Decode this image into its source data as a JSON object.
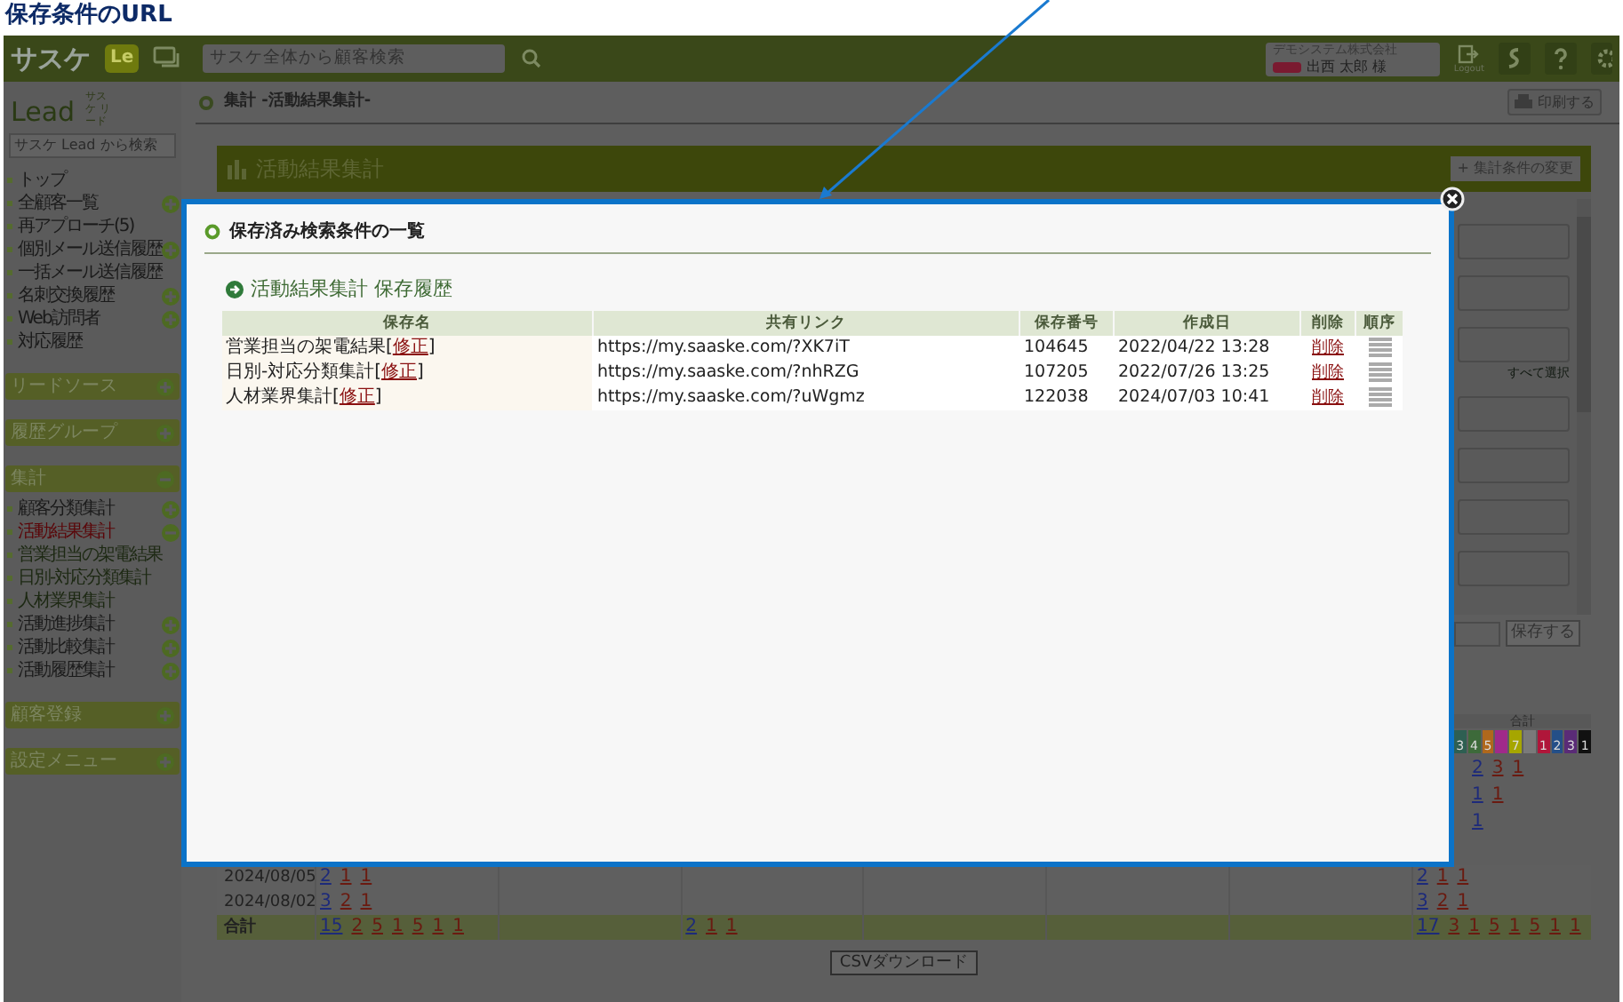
{
  "annotation": {
    "title": "保存条件のURL"
  },
  "header": {
    "logo": "サスケ",
    "app_badge": "Le",
    "search": {
      "placeholder": "サスケ全体から顧客検索"
    },
    "company": "デモシステム株式会社",
    "user": "出西 太郎 様",
    "logout": "Logout"
  },
  "sidebar": {
    "logo": "Lead",
    "logo_sub": "サスケ リード",
    "search": {
      "placeholder": "サスケ Lead から検索"
    },
    "items": [
      {
        "label": "トップ",
        "selected": false
      },
      {
        "label": "全顧客一覧",
        "selected": false,
        "expandable": true,
        "expanded": false
      },
      {
        "label": "再アプローチ(5)",
        "selected": false
      },
      {
        "label": "個別メール送信履歴",
        "selected": false,
        "expandable": true,
        "expanded": false
      },
      {
        "label": "一括メール送信履歴",
        "selected": false
      },
      {
        "label": "名刺交換履歴",
        "selected": false,
        "expandable": true,
        "expanded": false
      },
      {
        "label": "Web訪問者",
        "selected": false,
        "expandable": true,
        "expanded": false
      },
      {
        "label": "対応履歴",
        "selected": false
      }
    ],
    "sections": [
      {
        "title": "リードソース",
        "expanded": false
      },
      {
        "title": "履歴グループ",
        "expanded": false
      },
      {
        "title": "集計",
        "expanded": true,
        "items": [
          {
            "label": "顧客分類集計",
            "selected": false,
            "expandable": true,
            "expanded": false
          },
          {
            "label": "活動結果集計",
            "selected": true,
            "expandable": true,
            "expanded": true,
            "children": [
              {
                "label": "営業担当の架電結果",
                "selected": false
              },
              {
                "label": "日別-対応分類集計",
                "selected": false
              },
              {
                "label": "人材業界集計",
                "selected": false
              }
            ]
          },
          {
            "label": "活動進捗集計",
            "selected": false,
            "expandable": true,
            "expanded": false
          },
          {
            "label": "活動比較集計",
            "selected": false,
            "expandable": true,
            "expanded": false
          },
          {
            "label": "活動履歴集計",
            "selected": false,
            "expandable": true,
            "expanded": false
          }
        ]
      },
      {
        "title": "顧客登録",
        "expanded": false
      },
      {
        "title": "設定メニュー",
        "expanded": false
      }
    ]
  },
  "main": {
    "breadcrumb": "集計 -活動結果集計-",
    "print_button": "印刷する",
    "panel_title": "活動結果集計",
    "change_button": "+ 集計条件の変更",
    "select_all": "すべて選択",
    "save_button": "保存する",
    "totals": {
      "title": "合計",
      "badges": [
        {
          "label": "3",
          "color": "#2e5f52"
        },
        {
          "label": "4",
          "color": "#3d6a3a"
        },
        {
          "label": "5",
          "color": "#b0681c"
        },
        {
          "color": "#a02a8a"
        },
        {
          "label": "7",
          "color": "#a6a600"
        },
        {
          "color": "#7a7a7a"
        },
        {
          "label": "1",
          "color": "#b0163a"
        },
        {
          "label": "2",
          "color": "#244f88"
        },
        {
          "label": "3",
          "color": "#5a2b77"
        },
        {
          "label": "1",
          "color": "#111111"
        }
      ],
      "rows": [
        [
          "2",
          "3",
          "1"
        ],
        [
          "1",
          "1"
        ],
        [
          "1"
        ]
      ]
    },
    "table": {
      "rows": [
        {
          "label": "2024/08/05",
          "total": false,
          "groups": [
            {
              "kind": "counts",
              "values": [
                "2",
                "1",
                "1"
              ]
            },
            {
              "kind": "empty"
            },
            {
              "kind": "empty"
            },
            {
              "kind": "empty"
            },
            {
              "kind": "empty"
            },
            {
              "kind": "empty"
            },
            {
              "kind": "counts",
              "values": [
                "2",
                "1",
                "1"
              ]
            }
          ]
        },
        {
          "label": "2024/08/02",
          "total": false,
          "groups": [
            {
              "kind": "counts",
              "values": [
                "3",
                "2",
                "1"
              ]
            },
            {
              "kind": "empty"
            },
            {
              "kind": "empty"
            },
            {
              "kind": "empty"
            },
            {
              "kind": "empty"
            },
            {
              "kind": "empty"
            },
            {
              "kind": "counts",
              "values": [
                "3",
                "2",
                "1"
              ]
            }
          ]
        },
        {
          "label": "合計",
          "total": true,
          "groups": [
            {
              "kind": "counts",
              "values": [
                "15",
                "2",
                "5",
                "1",
                "5",
                "1",
                "1"
              ]
            },
            {
              "kind": "empty"
            },
            {
              "kind": "counts",
              "values": [
                "2",
                "1",
                "1"
              ]
            },
            {
              "kind": "empty"
            },
            {
              "kind": "empty"
            },
            {
              "kind": "empty"
            },
            {
              "kind": "counts",
              "values": [
                "17",
                "3",
                "1",
                "5",
                "1",
                "5",
                "1",
                "1"
              ]
            }
          ]
        }
      ]
    },
    "csv_button": "CSVダウンロード"
  },
  "modal": {
    "title": "保存済み検索条件の一覧",
    "section": "活動結果集計 保存履歴",
    "columns": [
      "保存名",
      "共有リンク",
      "保存番号",
      "作成日",
      "削除",
      "順序"
    ],
    "rows": [
      {
        "name": "営業担当の架電結果",
        "edit": {
          "open": "[",
          "label": "修正",
          "close": "]"
        },
        "link": "https://my.saaske.com/?XK7iT",
        "number": "104645",
        "date": "2022/04/22 13:28",
        "delete": "削除"
      },
      {
        "name": "日別-対応分類集計",
        "edit": {
          "open": "[",
          "label": "修正",
          "close": "]"
        },
        "link": "https://my.saaske.com/?nhRZG",
        "number": "107205",
        "date": "2022/07/26 13:25",
        "delete": "削除"
      },
      {
        "name": "人材業界集計",
        "edit": {
          "open": "[",
          "label": "修正",
          "close": "]"
        },
        "link": "https://my.saaske.com/?uWgmz",
        "number": "122038",
        "date": "2024/07/03 10:41",
        "delete": "削除"
      }
    ]
  }
}
